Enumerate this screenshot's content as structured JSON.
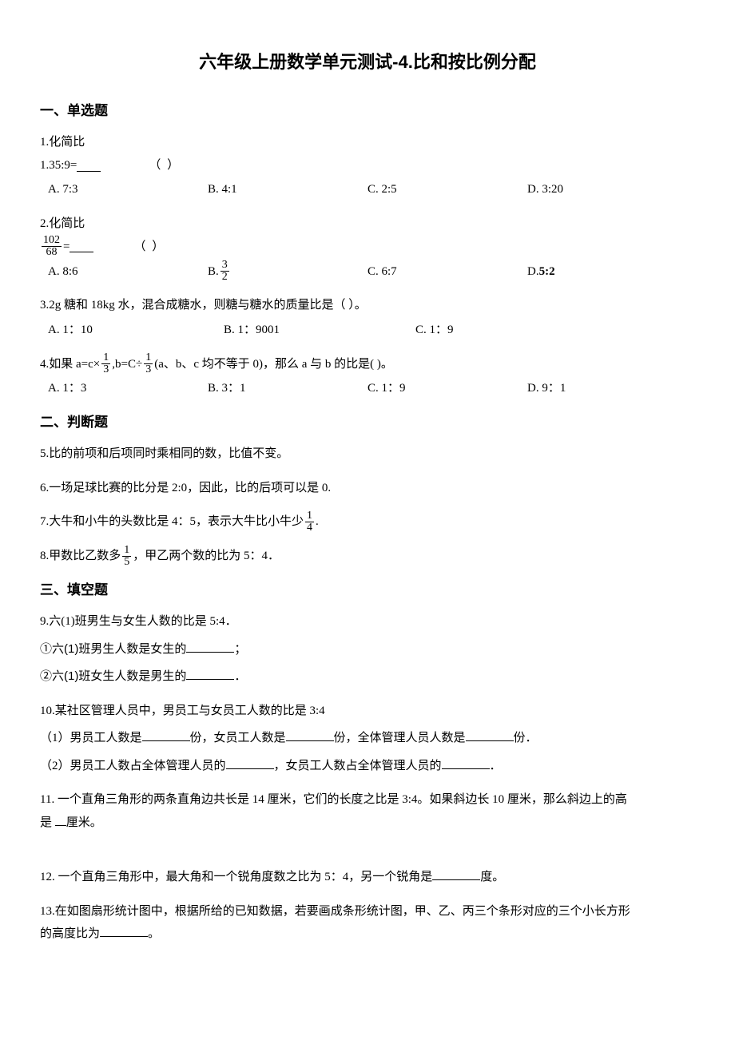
{
  "title": "六年级上册数学单元测试-4.比和按比例分配",
  "sections": {
    "s1": "一、单选题",
    "s2": "二、判断题",
    "s3": "三、填空题"
  },
  "q1": {
    "text": "1.化简比",
    "expr": "1.35:9=",
    "paren": "（   ）",
    "a": "A. 7:3",
    "b": "B. 4:1",
    "c": "C. 2:5",
    "d": "D. 3:20"
  },
  "q2": {
    "text": "2.化简比",
    "frac_num": "102",
    "frac_den": "68",
    "equals": " =",
    "paren": "（   ）",
    "a": "A. 8:6",
    "b_prefix": "B. ",
    "b_num": "3",
    "b_den": "2",
    "c": "C. 6:7",
    "d_prefix": "D. ",
    "d_val": "5:2"
  },
  "q3": {
    "text": "3.2g 糖和 18kg 水，混合成糖水，则糖与糖水的质量比是（   ）。",
    "a": "A. 1：10",
    "b": "B. 1：9001",
    "c": "C. 1：9"
  },
  "q4": {
    "pre": "4.如果 a=c×",
    "f1_num": "1",
    "f1_den": "3",
    "mid": ",b=C÷",
    "f2_num": "1",
    "f2_den": "3",
    "post": "(a、b、c 均不等于 0)，那么 a 与 b 的比是(  )。",
    "a": "A. 1：3",
    "b": "B. 3：1",
    "c": "C. 1：9",
    "d": "D. 9：1"
  },
  "q5": "5.比的前项和后项同时乘相同的数，比值不变。",
  "q6": "6.一场足球比赛的比分是 2:0，因此，比的后项可以是 0.",
  "q7": {
    "pre": "7.大牛和小牛的头数比是 4：5，表示大牛比小牛少 ",
    "num": "1",
    "den": "4",
    "post": "."
  },
  "q8": {
    "pre": "8.甲数比乙数多 ",
    "num": "1",
    "den": "5",
    "post": "，甲乙两个数的比为 5：4．"
  },
  "q9": {
    "text": "9.六(1)班男生与女生人数的比是 5:4．",
    "sub1_pre": "①六(1)班男生人数是女生的",
    "sub1_post": "；",
    "sub2_pre": "②六(1)班女生人数是男生的",
    "sub2_post": "．"
  },
  "q10": {
    "text": "10.某社区管理人员中，男员工与女员工人数的比是 3:4",
    "sub1_a": "（1）男员工人数是",
    "sub1_b": "份，女员工人数是",
    "sub1_c": "份，全体管理人员人数是",
    "sub1_d": "份．",
    "sub2_a": "（2）男员工人数占全体管理人员的",
    "sub2_b": "，女员工人数占全体管理人员的",
    "sub2_c": "．"
  },
  "q11": {
    "line1": "11. 一个直角三角形的两条直角边共长是 14 厘米，它们的长度之比是 3:4。如果斜边长 10 厘米，那么斜边上的高",
    "line2_pre": "是 ",
    "line2_post": "厘米。"
  },
  "q12": {
    "pre": "12. 一个直角三角形中，最大角和一个锐角度数之比为 5：4，另一个锐角是",
    "post": "度。"
  },
  "q13": {
    "line1": "13.在如图扇形统计图中，根据所给的已知数据，若要画成条形统计图，甲、乙、丙三个条形对应的三个小长方形",
    "line2_pre": "的高度比为",
    "line2_post": "。"
  }
}
